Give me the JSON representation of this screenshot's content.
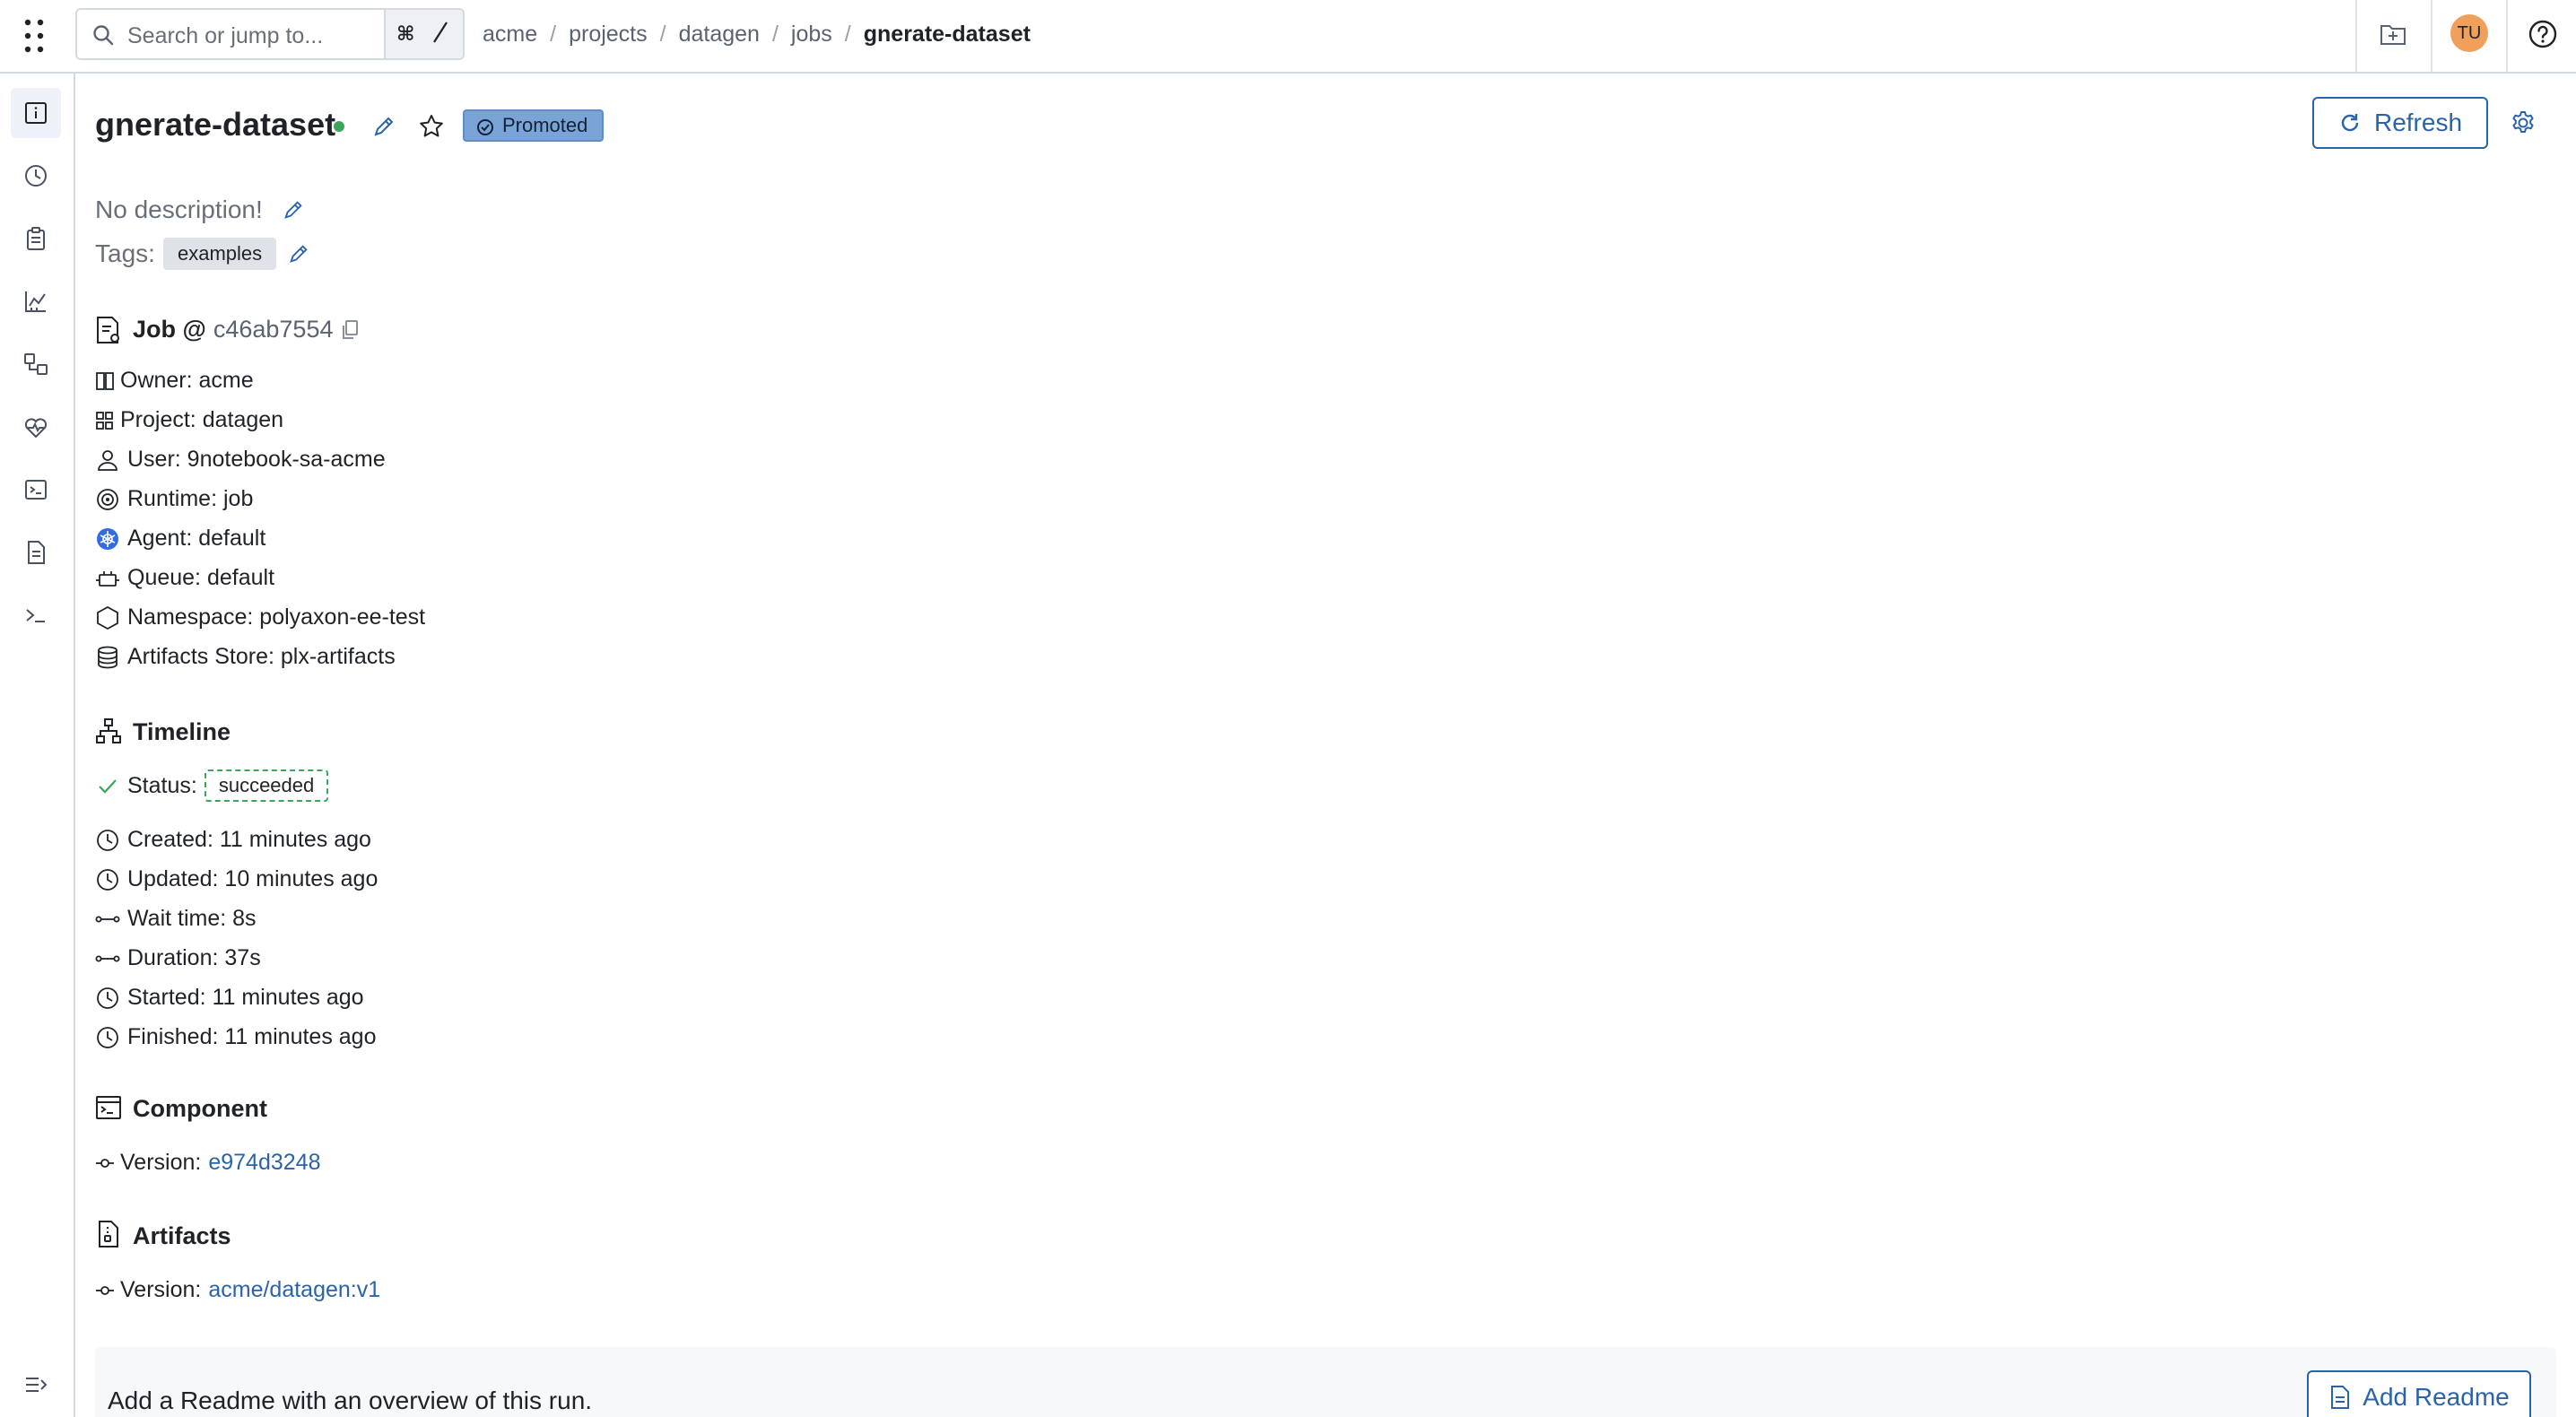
{
  "search": {
    "placeholder": "Search or jump to...",
    "shortcut_key": "⌘"
  },
  "breadcrumb": [
    "acme",
    "projects",
    "datagen",
    "jobs",
    "gnerate-dataset"
  ],
  "user": {
    "initials": "TU"
  },
  "colors": {
    "accent": "#2b63a8",
    "success": "#3ca55c",
    "promoted_bg": "#7aa4d6",
    "avatar_bg": "#f0a05a"
  },
  "sidebar": {
    "icons": [
      "info-icon",
      "history-icon",
      "clipboard-icon",
      "chart-icon",
      "lineage-icon",
      "health-icon",
      "terminal-window-icon",
      "document-icon",
      "shell-prompt-icon"
    ],
    "collapse_icon": "expand-sidebar-icon"
  },
  "header": {
    "title": "gnerate-dataset",
    "badge": "Promoted",
    "refresh_label": "Refresh"
  },
  "description": "No description!",
  "tags": {
    "label": "Tags:",
    "items": [
      "examples"
    ]
  },
  "job": {
    "title": "Job @",
    "commit": "c46ab7554",
    "fields": [
      {
        "icon": "owner-icon",
        "text": "Owner: acme"
      },
      {
        "icon": "project-icon",
        "text": "Project: datagen"
      },
      {
        "icon": "user-icon",
        "text": "User: 9notebook-sa-acme"
      },
      {
        "icon": "runtime-icon",
        "text": "Runtime: job"
      },
      {
        "icon": "kubernetes-icon",
        "text": "Agent: default"
      },
      {
        "icon": "queue-icon",
        "text": "Queue: default"
      },
      {
        "icon": "namespace-icon",
        "text": "Namespace: polyaxon-ee-test"
      },
      {
        "icon": "database-icon",
        "text": "Artifacts Store: plx-artifacts"
      }
    ]
  },
  "timeline": {
    "title": "Timeline",
    "status_label": "Status:",
    "status_value": "succeeded",
    "fields": [
      {
        "icon": "clock-icon",
        "text": "Created: 11 minutes ago"
      },
      {
        "icon": "clock-icon",
        "text": "Updated: 10 minutes ago"
      },
      {
        "icon": "duration-icon",
        "text": "Wait time: 8s"
      },
      {
        "icon": "duration-icon",
        "text": "Duration: 37s"
      },
      {
        "icon": "clock-icon",
        "text": "Started: 11 minutes ago"
      },
      {
        "icon": "clock-icon",
        "text": "Finished: 11 minutes ago"
      }
    ]
  },
  "component": {
    "title": "Component",
    "version_label": "Version:",
    "version_value": "e974d3248"
  },
  "artifacts": {
    "title": "Artifacts",
    "version_label": "Version:",
    "version_value": "acme/datagen:v1"
  },
  "readme": {
    "text": "Add a Readme with an overview of this run.",
    "button_label": "Add Readme"
  }
}
